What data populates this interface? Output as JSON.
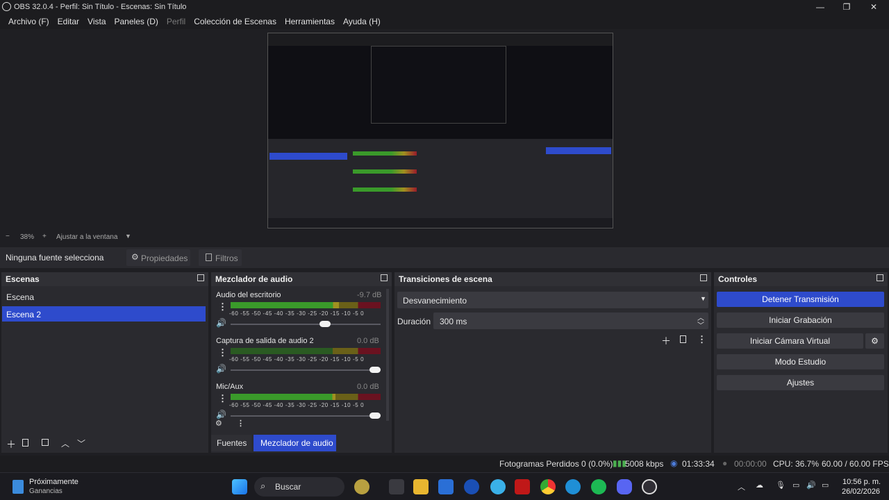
{
  "window": {
    "title": "OBS 32.0.4 - Perfil: Sin Título - Escenas: Sin Título"
  },
  "menu": [
    {
      "label": "Archivo (F)",
      "disabled": false
    },
    {
      "label": "Editar",
      "disabled": false
    },
    {
      "label": "Vista",
      "disabled": false
    },
    {
      "label": "Paneles (D)",
      "disabled": false
    },
    {
      "label": "Perfil",
      "disabled": true
    },
    {
      "label": "Colección de Escenas",
      "disabled": false
    },
    {
      "label": "Herramientas",
      "disabled": false
    },
    {
      "label": "Ayuda (H)",
      "disabled": false
    }
  ],
  "zoom": {
    "minus": "−",
    "value": "38%",
    "plus": "+",
    "fit_label": "Ajustar a la ventana"
  },
  "source_toolbar": {
    "status": "Ninguna fuente selecciona",
    "properties": "Propiedades",
    "filters": "Filtros"
  },
  "scenes": {
    "title": "Escenas",
    "items": [
      {
        "label": "Escena",
        "selected": false
      },
      {
        "label": "Escena 2",
        "selected": true
      }
    ]
  },
  "mixer": {
    "title": "Mezclador de audio",
    "channels": [
      {
        "name": "Audio del escritorio",
        "db": "-9.7 dB",
        "level": 0.72,
        "volume": 0.64
      },
      {
        "name": "Captura de salida de audio 2",
        "db": "0.0 dB",
        "level": 0.0,
        "volume": 1.0
      },
      {
        "name": "Mic/Aux",
        "db": "0.0 dB",
        "level": 0.7,
        "volume": 1.0
      }
    ],
    "scale": "-60 -55 -50 -45 -40 -35 -30 -25 -20 -15 -10 -5 0",
    "tabs": [
      {
        "label": "Fuentes",
        "active": false
      },
      {
        "label": "Mezclador de audio",
        "active": true
      }
    ]
  },
  "transitions": {
    "title": "Transiciones de escena",
    "selected": "Desvanecimiento",
    "duration_label": "Duración",
    "duration_value": "300 ms"
  },
  "controls": {
    "title": "Controles",
    "buttons": [
      {
        "label": "Detener Transmisión",
        "active": true
      },
      {
        "label": "Iniciar Grabación",
        "active": false
      },
      {
        "label": "Iniciar Cámara Virtual",
        "active": false
      },
      {
        "label": "Modo Estudio",
        "active": false
      },
      {
        "label": "Ajustes",
        "active": false
      }
    ]
  },
  "status": {
    "dropped": "Fotogramas Perdidos 0 (0.0%)",
    "bitrate": "5008 kbps",
    "stream_time": "01:33:34",
    "rec_time": "00:00:00",
    "cpu": "CPU: 36.7%",
    "fps": "60.00 / 60.00 FPS"
  },
  "taskbar": {
    "widget_title": "Próximamente",
    "widget_sub": "Ganancias",
    "search": "Buscar",
    "time": "10:56 p. m.",
    "date": "26/02/2026"
  },
  "colors": {
    "accent": "#2e4bcc",
    "meter_green": "#3a9a2a",
    "meter_yellow": "#a09020",
    "meter_red": "#9a1a2a"
  }
}
